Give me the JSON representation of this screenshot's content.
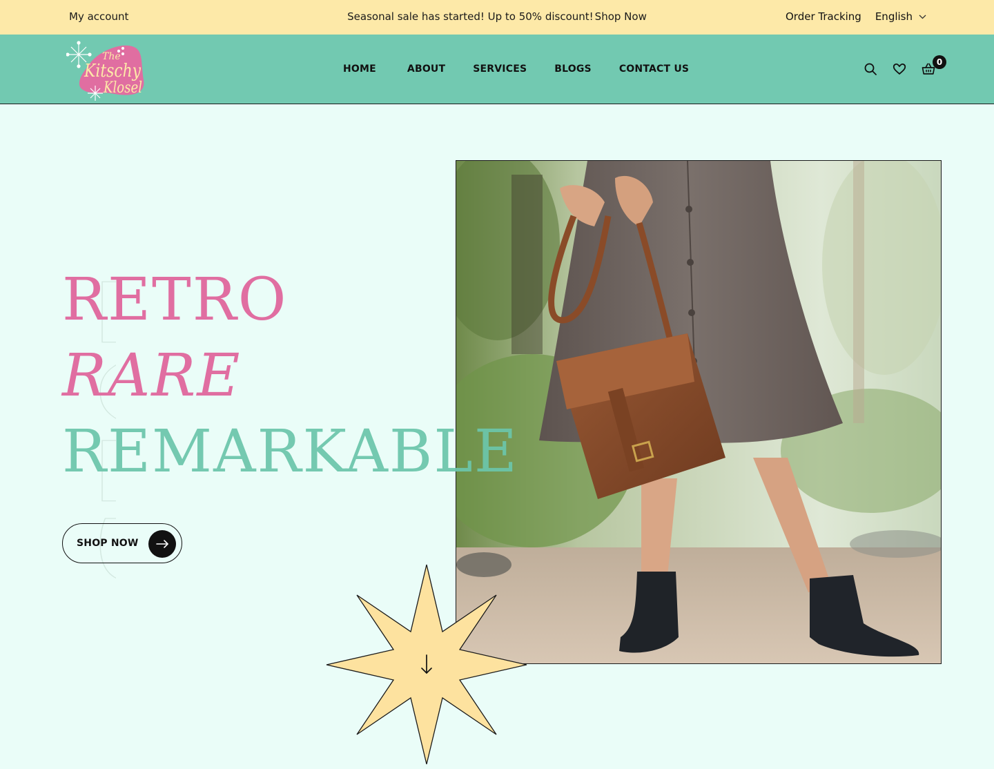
{
  "topbar": {
    "account_label": "My account",
    "promo_text": "Seasonal sale has started! Up to 50% discount!",
    "promo_link": "Shop Now",
    "order_tracking": "Order Tracking",
    "language": "English"
  },
  "header": {
    "logo_alt": "The Kitschy Klosel",
    "nav": [
      "HOME",
      "ABOUT",
      "SERVICES",
      "BLOGS",
      "CONTACT US"
    ],
    "cart_count": "0",
    "icons": [
      "search-icon",
      "heart-icon",
      "basket-icon"
    ]
  },
  "hero": {
    "line1": "RETRO",
    "line2": "RARE",
    "line3": "REMARKABLE",
    "watermark": "2023",
    "cta_label": "SHOP NOW"
  },
  "colors": {
    "topbar_bg": "#fde9a8",
    "header_bg": "#72c9b1",
    "page_bg": "#eafdf8",
    "pink": "#e06ea1",
    "teal": "#6cc6ab",
    "star": "#fde29f"
  }
}
